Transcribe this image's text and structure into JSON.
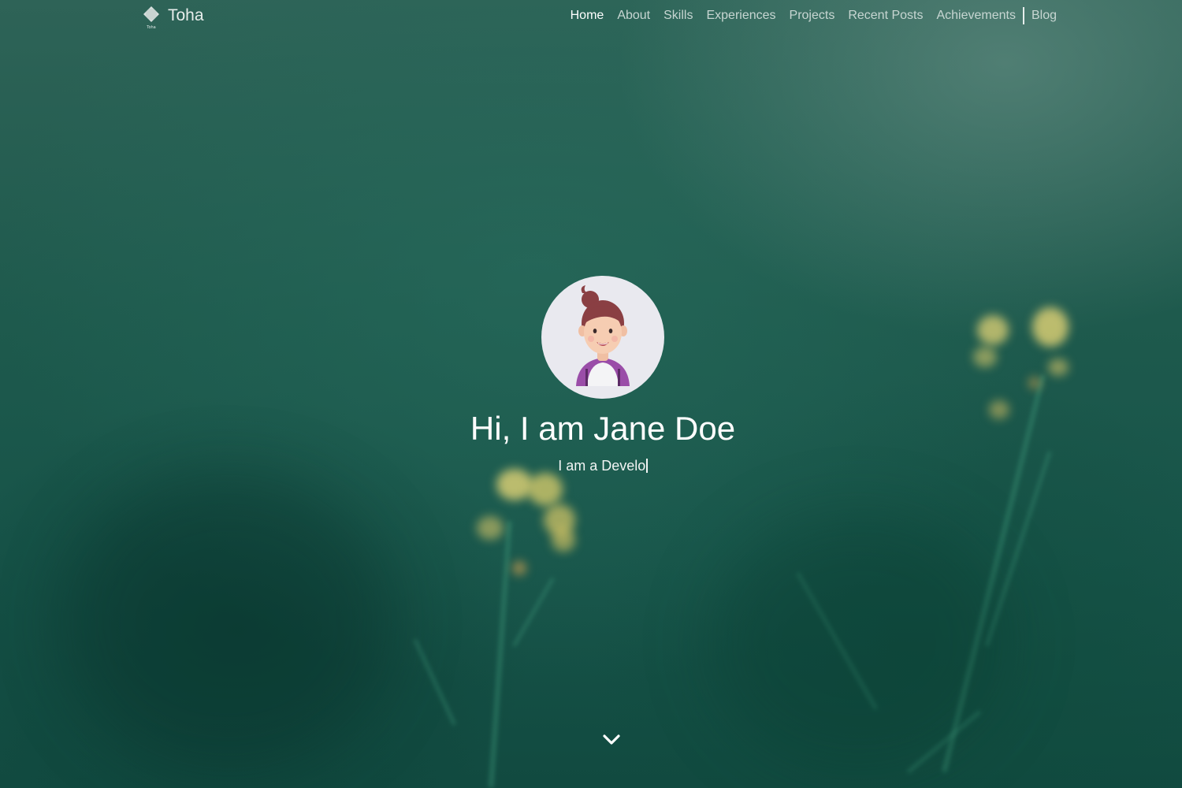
{
  "navbar": {
    "brand": {
      "name": "Toha",
      "logo_caption": "Toha",
      "logo_icon": "toha-logo-icon"
    },
    "links": [
      {
        "label": "Home",
        "active": true
      },
      {
        "label": "About",
        "active": false
      },
      {
        "label": "Skills",
        "active": false
      },
      {
        "label": "Experiences",
        "active": false
      },
      {
        "label": "Projects",
        "active": false
      },
      {
        "label": "Recent Posts",
        "active": false
      },
      {
        "label": "Achievements",
        "active": false
      }
    ],
    "blog_label": "Blog"
  },
  "hero": {
    "avatar_icon": "female-avatar-icon",
    "greeting": "Hi, I am Jane Doe",
    "typing_text": "I am a Develo",
    "scroll_icon": "chevron-down-icon"
  },
  "colors": {
    "background": "#1e5a4d",
    "text": "#ffffff",
    "nav_text": "#c7d6d2"
  }
}
